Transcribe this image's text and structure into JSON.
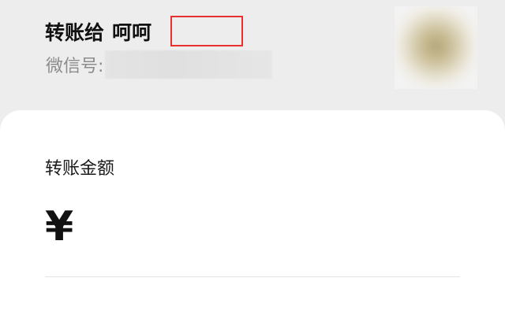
{
  "header": {
    "transfer_to_label": "转账给",
    "recipient_name": "呵呵",
    "wechat_id_label": "微信号:"
  },
  "amount": {
    "label": "转账金额",
    "currency_symbol": "¥",
    "value": ""
  },
  "colors": {
    "page_background": "#ededed",
    "card_background": "#ffffff",
    "redaction_outline": "#e8302e"
  },
  "icons": {
    "avatar": "recipient-avatar"
  }
}
